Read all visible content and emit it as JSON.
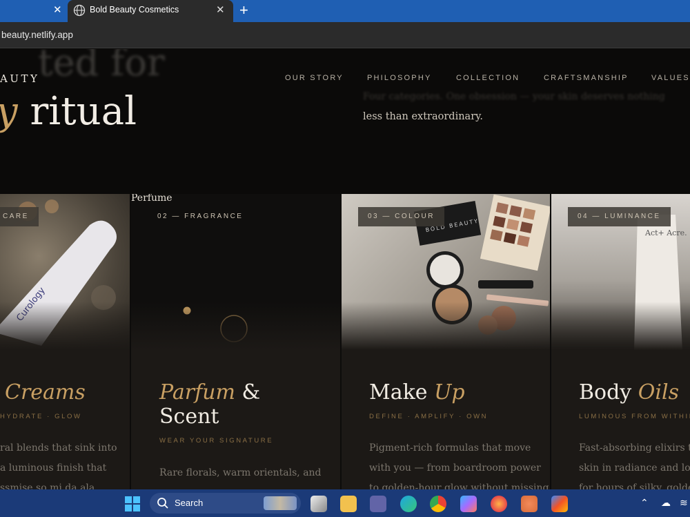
{
  "browser": {
    "prev_tab_close": "✕",
    "active_tab_title": "Bold Beauty Cosmetics",
    "active_tab_close": "✕",
    "new_tab": "+",
    "url": "beauty.netlify.app"
  },
  "site": {
    "brand": "AUTY",
    "hero_line1": "ted for",
    "hero_line2_italic": "y",
    "hero_line2_rest": " ritual",
    "nav": [
      "OUR STORY",
      "PHILOSOPHY",
      "COLLECTION",
      "CRAFTSMANSHIP",
      "VALUES"
    ],
    "intro_blurred": "Four categories. One obsession — your skin deserves nothing",
    "intro": "less than extraordinary."
  },
  "cards": [
    {
      "tag": "CARE",
      "title_italic": "Creams",
      "subtitle": "HYDRATE · GLOW",
      "desc": [
        "ral blends that sink into",
        "a luminous finish that",
        "ssmise so mi da ala"
      ]
    },
    {
      "img_alt": "Perfume",
      "tag": "02 — FRAGRANCE",
      "title_italic": "Parfum",
      "title_rest": " &",
      "title_line2": "Scent",
      "subtitle": "WEAR YOUR SIGNATURE",
      "desc": [
        "Rare florals, warm orientals, and"
      ]
    },
    {
      "tag": "03 — COLOUR",
      "title_plain": "Make ",
      "title_italic": "Up",
      "subtitle": "DEFINE · AMPLIFY · OWN",
      "desc": [
        "Pigment-rich formulas that move",
        "with you — from boardroom power",
        "to golden-hour glow without missing"
      ],
      "product_text": "BOLD BEAUTY"
    },
    {
      "tag": "04 — LUMINANCE",
      "title_plain": "Body ",
      "title_italic": "Oils",
      "subtitle": "LUMINOUS FROM WITHIN",
      "desc": [
        "Fast-absorbing elixirs that d",
        "skin in radiance and lock in",
        "for hours of silky, golden lu"
      ],
      "product_text": "Act+ Acre."
    }
  ],
  "taskbar": {
    "search_label": "Search"
  },
  "colors": {
    "accent_gold": "#c9a063",
    "tab_blue": "#1f5fb3",
    "taskbar": "#1b3a78"
  }
}
